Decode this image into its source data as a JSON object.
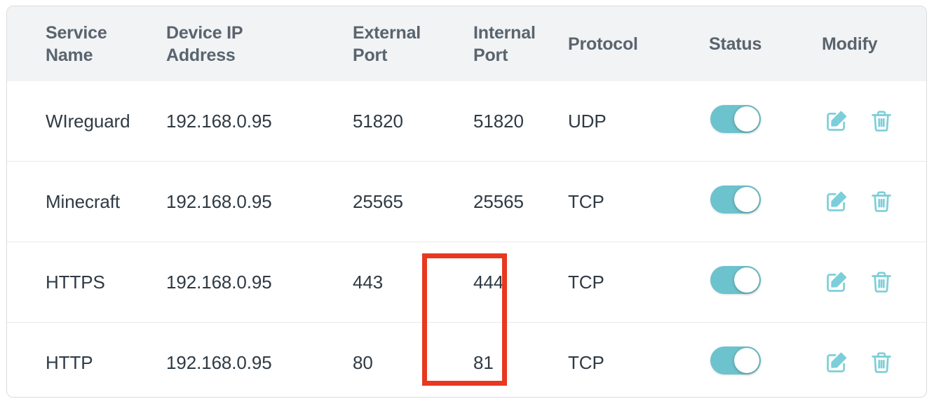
{
  "panel": {
    "name": "port-forwarding-table",
    "accent_color": "#6cc3cd",
    "header_bg": "#f2f3f4",
    "header_text_color": "#59646f",
    "body_text_color": "#2f3a44",
    "row_divider_color": "#e9eaeb",
    "border_color": "#dcdcdc"
  },
  "table": {
    "columns": [
      {
        "key": "service_name",
        "label": "Service\nName"
      },
      {
        "key": "device_ip",
        "label": "Device IP\nAddress"
      },
      {
        "key": "external_port",
        "label": "External\nPort"
      },
      {
        "key": "internal_port",
        "label": "Internal\nPort"
      },
      {
        "key": "protocol",
        "label": "Protocol"
      },
      {
        "key": "status",
        "label": "Status"
      },
      {
        "key": "modify",
        "label": "Modify"
      }
    ],
    "rows": [
      {
        "service_name": "WIreguard",
        "device_ip": "192.168.0.95",
        "external_port": "51820",
        "internal_port": "51820",
        "protocol": "UDP",
        "status_enabled": true
      },
      {
        "service_name": "Minecraft",
        "device_ip": "192.168.0.95",
        "external_port": "25565",
        "internal_port": "25565",
        "protocol": "TCP",
        "status_enabled": true
      },
      {
        "service_name": "HTTPS",
        "device_ip": "192.168.0.95",
        "external_port": "443",
        "internal_port": "444",
        "protocol": "TCP",
        "status_enabled": true
      },
      {
        "service_name": "HTTP",
        "device_ip": "192.168.0.95",
        "external_port": "80",
        "internal_port": "81",
        "protocol": "TCP",
        "status_enabled": true
      }
    ]
  },
  "modify_actions": {
    "edit_icon": "edit-pencil-square-icon",
    "delete_icon": "trash-icon"
  },
  "annotation": {
    "type": "rectangle-highlight",
    "color": "#e8381f",
    "target_column": "Internal Port",
    "target_values": [
      "444",
      "81"
    ]
  }
}
